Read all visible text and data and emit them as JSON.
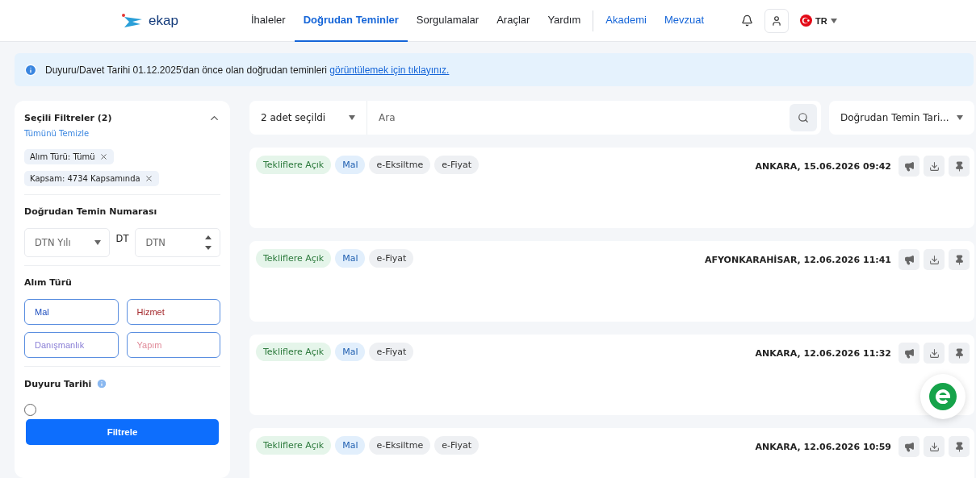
{
  "header": {
    "logo": "ekap",
    "nav": [
      {
        "label": "İhaleler",
        "kind": "menu",
        "selected": false
      },
      {
        "label": "Doğrudan Teminler",
        "kind": "menu",
        "selected": true
      },
      {
        "label": "Sorgulamalar",
        "kind": "menu",
        "selected": false
      },
      {
        "label": "Araçlar",
        "kind": "menu",
        "selected": false
      },
      {
        "label": "Yardım",
        "kind": "menu",
        "selected": false
      },
      {
        "label": "Akademi",
        "kind": "link",
        "selected": false
      },
      {
        "label": "Mevzuat",
        "kind": "link",
        "selected": false
      }
    ],
    "language": "TR"
  },
  "notice": {
    "text": "Duyuru/Davet Tarihi 01.12.2025'dan önce olan doğrudan teminleri",
    "link": "görüntülemek için tıklayınız."
  },
  "filters": {
    "title": "Seçili Filtreler (2)",
    "clear": "Tümünü Temizle",
    "chips": [
      "Alım Türü: Tümü",
      "Kapsam: 4734 Kapsamında"
    ],
    "number_section": {
      "title": "Doğrudan Temin Numarası",
      "year_placeholder": "DTN Yılı",
      "prefix": "DT",
      "number_placeholder": "DTN"
    },
    "type_section": {
      "title": "Alım Türü",
      "options": [
        {
          "label": "Mal",
          "color": "#1f4fbf"
        },
        {
          "label": "Hizmet",
          "color": "#a3262a"
        },
        {
          "label": "Danışmanlık",
          "color": "#8a7fd6"
        },
        {
          "label": "Yapım",
          "color": "#e08a98"
        }
      ]
    },
    "date_section": {
      "title": "Duyuru Tarihi"
    },
    "submit": "Filtrele"
  },
  "toolbar": {
    "selection": "2 adet seçildi",
    "search_placeholder": "Ara",
    "sort": "Doğrudan Temin Tari..."
  },
  "results": [
    {
      "tags": [
        {
          "label": "Tekliflere Açık",
          "kind": "status"
        },
        {
          "label": "Mal",
          "kind": "type"
        },
        {
          "label": "e-Eksiltme",
          "kind": "method"
        },
        {
          "label": "e-Fiyat",
          "kind": "method"
        }
      ],
      "place_date": "ANKARA, 15.06.2026 09:42"
    },
    {
      "tags": [
        {
          "label": "Tekliflere Açık",
          "kind": "status"
        },
        {
          "label": "Mal",
          "kind": "type"
        },
        {
          "label": "e-Fiyat",
          "kind": "method"
        }
      ],
      "place_date": "AFYONKARAHİSAR, 12.06.2026 11:41"
    },
    {
      "tags": [
        {
          "label": "Tekliflere Açık",
          "kind": "status"
        },
        {
          "label": "Mal",
          "kind": "type"
        },
        {
          "label": "e-Fiyat",
          "kind": "method"
        }
      ],
      "place_date": "ANKARA, 12.06.2026 11:32"
    },
    {
      "tags": [
        {
          "label": "Tekliflere Açık",
          "kind": "status"
        },
        {
          "label": "Mal",
          "kind": "type"
        },
        {
          "label": "e-Eksiltme",
          "kind": "method"
        },
        {
          "label": "e-Fiyat",
          "kind": "method"
        }
      ],
      "place_date": "ANKARA, 12.06.2026 10:59"
    }
  ]
}
